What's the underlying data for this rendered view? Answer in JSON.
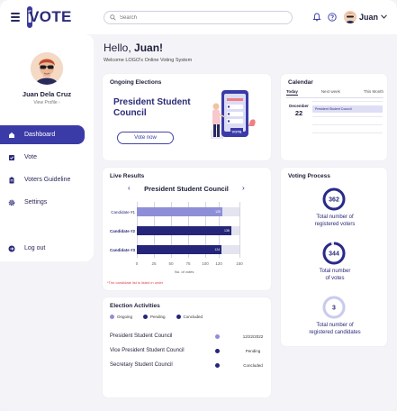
{
  "header": {
    "logo": "iVOTE",
    "search_placeholder": "Search",
    "user_name": "Juan"
  },
  "sidebar": {
    "profile_name": "Juan Dela Cruz",
    "view_profile": "View Profile",
    "items": [
      {
        "label": "Dashboard",
        "active": true
      },
      {
        "label": "Vote",
        "active": false
      },
      {
        "label": "Voters Guideline",
        "active": false
      },
      {
        "label": "Settings",
        "active": false
      },
      {
        "label": "Log out",
        "active": false
      }
    ]
  },
  "greeting": {
    "hello": "Hello, ",
    "name": "Juan!",
    "welcome": "Welcome LOGO's Online Voting System"
  },
  "ongoing": {
    "title": "Ongoing Elections",
    "election": "President Student Council",
    "button": "Vote now",
    "illustration_label": "VOTE"
  },
  "calendar": {
    "title": "Calendar",
    "tabs": [
      "Today",
      "Next week",
      "This Month"
    ],
    "month": "December",
    "day": "22",
    "event": "President Student Council"
  },
  "live_results": {
    "title": "Live Results",
    "election": "President Student Council",
    "xlabel": "No. of votes",
    "note": "*The candidate list is listed in order",
    "ticks": [
      "0",
      "25",
      "50",
      "75",
      "100",
      "120",
      "150"
    ]
  },
  "chart_data": {
    "type": "bar",
    "title": "President Student Council",
    "xlabel": "No. of votes",
    "categories": [
      "Candidate #1",
      "Candidate #2",
      "Candidate #3"
    ],
    "values": [
      125,
      138,
      124
    ],
    "value_labels": [
      "125",
      "138",
      "124"
    ],
    "colors": [
      "#8e8ed8",
      "#25257a",
      "#25257a"
    ],
    "xlim": [
      0,
      150
    ],
    "grid": true
  },
  "activities": {
    "title": "Election Activities",
    "legend": [
      {
        "label": "Ongoing",
        "color": "#8e8ed8"
      },
      {
        "label": "Pending",
        "color": "#25257a"
      },
      {
        "label": "Concluded",
        "color": "#25257a"
      }
    ],
    "rows": [
      {
        "name": "President Student Council",
        "status": "12/22/2022",
        "color": "#8e8ed8"
      },
      {
        "name": "Vice President Student Council",
        "status": "Pending",
        "color": "#25257a"
      },
      {
        "name": "Secretary Student Council",
        "status": "Concluded",
        "color": "#25257a"
      }
    ]
  },
  "voting_process": {
    "title": "Voting Process",
    "items": [
      {
        "value": "362",
        "label_1": "Total number of",
        "label_2": "registered voters",
        "fill": 1.0,
        "color": "#2a2a8a"
      },
      {
        "value": "344",
        "label_1": "Total number",
        "label_2": "of votes",
        "fill": 0.95,
        "color": "#2a2a8a"
      },
      {
        "value": "3",
        "label_1": "Total number of",
        "label_2": "registered candidates",
        "fill": 1.0,
        "color": "#c9cbee"
      }
    ]
  }
}
